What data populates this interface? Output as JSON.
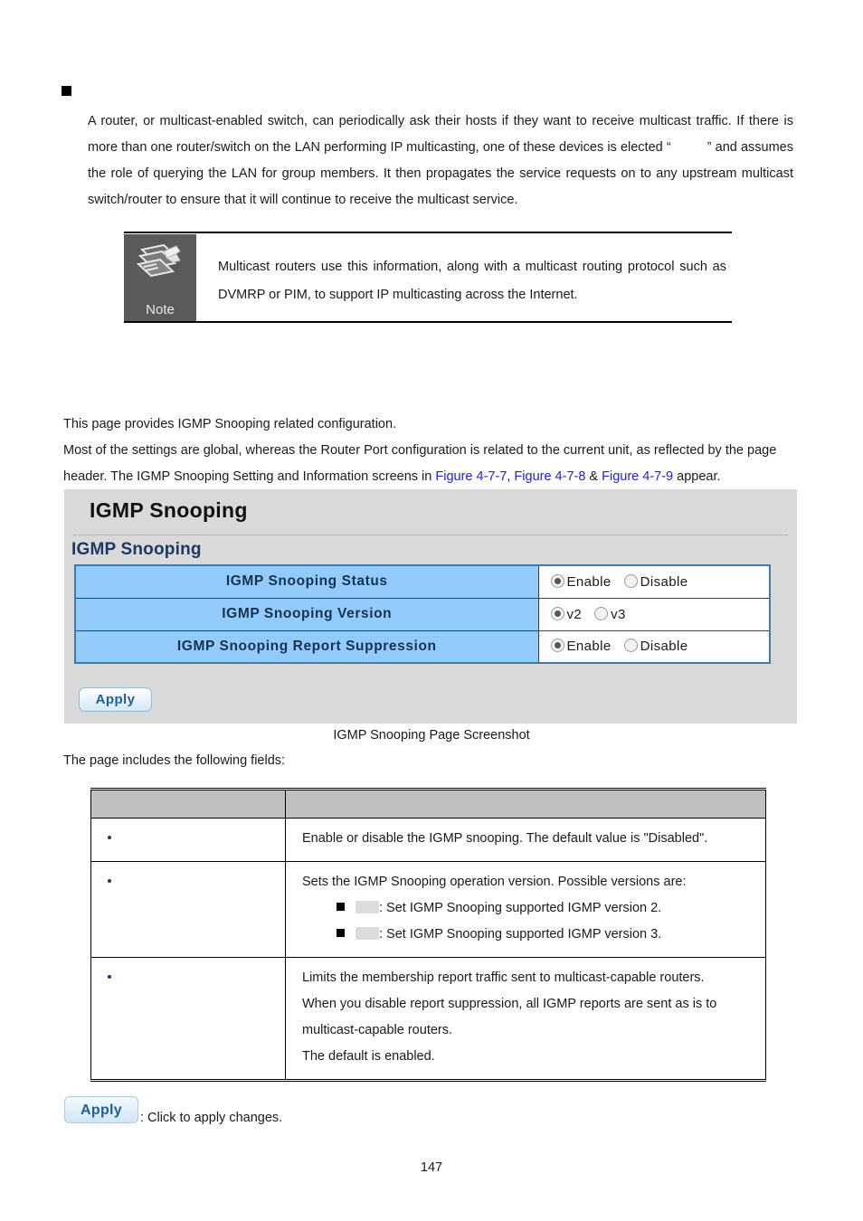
{
  "section": {
    "bullet_heading": "",
    "paragraph_part1": "A router, or multicast-enabled switch, can periodically ask their hosts if they want to receive multicast traffic. If there is more than one router/switch on the LAN performing IP multicasting, one of these devices is elected “",
    "paragraph_part2": "” and assumes the role of querying the LAN for group members. It then propagates the service requests on to any upstream multicast switch/router to ensure that it will continue to receive the multicast service."
  },
  "note": {
    "label": "Note",
    "text": "Multicast routers use this information, along with a multicast routing protocol such as DVMRP or PIM, to support IP multicasting across the Internet."
  },
  "intro": {
    "line1": "This page provides IGMP Snooping related configuration.",
    "line2_a": "Most of the settings are global, whereas the Router Port configuration is related to the current unit, as reflected by the page header. The IGMP Snooping Setting and Information screens in ",
    "link1": "Figure 4-7-7",
    "sep1": ", ",
    "link2": "Figure 4-7-8",
    "sep2": " & ",
    "link3": "Figure 4-7-9",
    "line2_b": " appear."
  },
  "screenshot": {
    "window_title": "IGMP Snooping",
    "section_title": "IGMP Snooping",
    "rows": [
      {
        "label": "IGMP Snooping Status",
        "options": [
          {
            "text": "Enable",
            "selected": true
          },
          {
            "text": "Disable",
            "selected": false
          }
        ]
      },
      {
        "label": "IGMP Snooping Version",
        "options": [
          {
            "text": "v2",
            "selected": true
          },
          {
            "text": "v3",
            "selected": false
          }
        ]
      },
      {
        "label": "IGMP Snooping Report Suppression",
        "options": [
          {
            "text": "Enable",
            "selected": true
          },
          {
            "text": "Disable",
            "selected": false
          }
        ]
      }
    ],
    "apply_label": "Apply"
  },
  "figure_caption": "IGMP Snooping Page Screenshot",
  "fields_intro": "The page includes the following fields:",
  "fields_table": {
    "headers": [
      "",
      ""
    ],
    "rows": [
      {
        "name": "",
        "description": "Enable or disable the IGMP snooping. The default value is \"Disabled\".",
        "sub_items": [],
        "extra_lines": []
      },
      {
        "name": "",
        "description": "Sets the IGMP Snooping operation version. Possible versions are:",
        "sub_items": [
          {
            "label": "",
            "text": ": Set IGMP Snooping supported IGMP version 2."
          },
          {
            "label": "",
            "text": ": Set IGMP Snooping supported IGMP version 3."
          }
        ],
        "extra_lines": []
      },
      {
        "name": "",
        "description": "Limits the membership report traffic sent to multicast-capable routers.",
        "sub_items": [],
        "extra_lines": [
          "When you disable report suppression, all IGMP reports are sent as is to",
          "multicast-capable routers.",
          "The default is enabled."
        ]
      }
    ]
  },
  "apply_legend": {
    "button_label": "Apply",
    "text": ": Click to apply changes."
  },
  "page_number": "147",
  "colors": {
    "table_label_blue": "#93cbfd",
    "section_title_navy": "#1f3864",
    "link_blue": "#2222dd",
    "panel_gray": "#d9d9d9",
    "note_gray": "#5a5a5a",
    "header_gray": "#c0c0c0"
  }
}
